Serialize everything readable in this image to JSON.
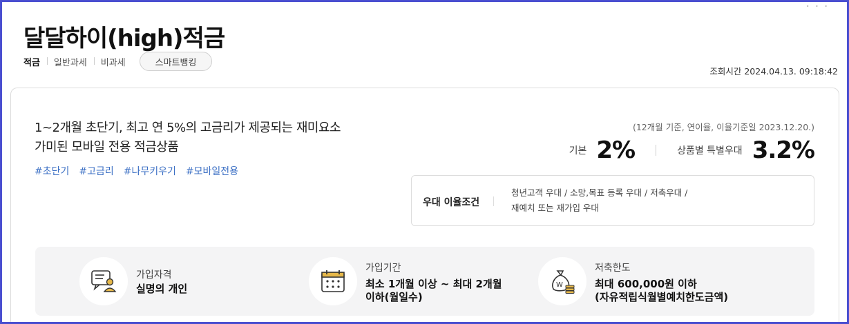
{
  "product": {
    "title": "달달하이(high)적금"
  },
  "tags": [
    "적금",
    "일반과세",
    "비과세"
  ],
  "smart_banking_label": "스마트뱅킹",
  "query_time": "조회시간 2024.04.13. 09:18:42",
  "description": {
    "line1": "1~2개월 초단기, 최고 연 5%의 고금리가 제공되는 재미요소",
    "line2": "가미된 모바일 전용 적금상품"
  },
  "hashtags": [
    "#초단기",
    "#고금리",
    "#나무키우기",
    "#모바일전용"
  ],
  "rates": {
    "note": "(12개월 기준, 연이율, 이율기준일 2023.12.20.)",
    "base_label": "기본",
    "base_value": "2%",
    "special_label": "상품별 특별우대",
    "special_value": "3.2%"
  },
  "conditions": {
    "title": "우대 이율조건",
    "line1": "청년고객 우대  /  소망,목표 등록 우대  /  저축우대  /",
    "line2": "재예치 또는 재가입 우대"
  },
  "info": {
    "eligibility": {
      "label": "가입자격",
      "value": "실명의 개인",
      "icon": "person-chat-icon"
    },
    "period": {
      "label": "가입기간",
      "value_line1": "최소 1개월 이상 ~ 최대 2개월",
      "value_line2": "이하(월일수)",
      "icon": "calendar-icon"
    },
    "limit": {
      "label": "저축한도",
      "value_line1": "최대 600,000원 이하",
      "value_line2": "(자유적립식월별예치한도금액)",
      "icon": "money-bag-icon"
    }
  },
  "colors": {
    "accent_blue": "#3b6fc4",
    "icon_gold": "#e6b84a",
    "panel_bg": "#f4f4f5",
    "frame": "#4a4fd0"
  }
}
